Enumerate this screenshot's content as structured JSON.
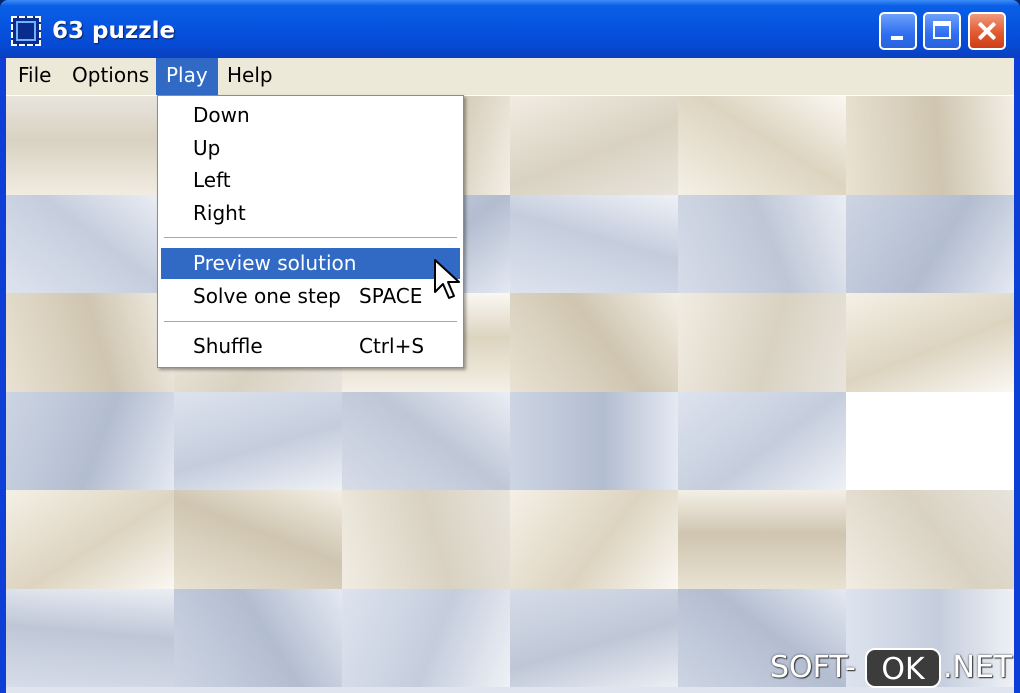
{
  "window": {
    "title": "63 puzzle",
    "icon": "puzzle-app-icon",
    "controls": [
      "minimize-icon",
      "maximize-icon",
      "close-icon"
    ]
  },
  "menubar": {
    "items": [
      {
        "label": "File"
      },
      {
        "label": "Options"
      },
      {
        "label": "Play",
        "active": true
      },
      {
        "label": "Help"
      }
    ]
  },
  "play_menu": {
    "items": [
      {
        "label": "Down",
        "shortcut": ""
      },
      {
        "label": "Up",
        "shortcut": ""
      },
      {
        "label": "Left",
        "shortcut": ""
      },
      {
        "label": "Right",
        "shortcut": ""
      },
      {
        "label": "Preview solution",
        "shortcut": "",
        "highlighted": true
      },
      {
        "label": "Solve one step",
        "shortcut": "SPACE"
      },
      {
        "label": "Shuffle",
        "shortcut": "Ctrl+S"
      }
    ]
  },
  "board": {
    "columns": 6,
    "rows": 6,
    "empty_tile": {
      "row": 3,
      "column": 5
    }
  },
  "watermark": {
    "left": "SOFT-",
    "boxed": "OK",
    "right": ".NET"
  },
  "colors": {
    "titlebar": "#0654e0",
    "menu_highlight": "#316ac5",
    "menubar": "#ece9d8",
    "close_button": "#e25a32"
  }
}
